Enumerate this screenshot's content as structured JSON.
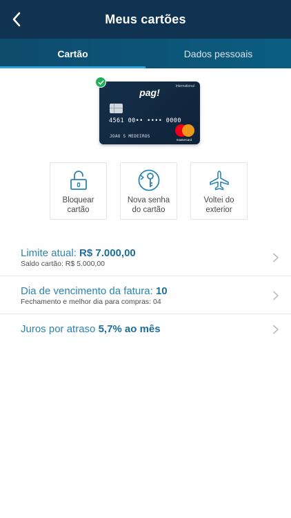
{
  "header": {
    "title": "Meus cartões"
  },
  "tabs": [
    {
      "label": "Cartão",
      "active": true
    },
    {
      "label": "Dados pessoais",
      "active": false
    }
  ],
  "card": {
    "brand": "pag!",
    "type": "International",
    "number": "4561 00•• •••• 0000",
    "holder": "JOAO S MEDEIROS",
    "network": "mastercard",
    "selected": true
  },
  "actions": [
    {
      "line1": "Bloquear",
      "line2": "cartão",
      "icon": "padlock-icon"
    },
    {
      "line1": "Nova senha",
      "line2": "do cartão",
      "icon": "key-icon"
    },
    {
      "line1": "Voltei do",
      "line2": "exterior",
      "icon": "airplane-icon"
    }
  ],
  "rows": [
    {
      "label": "Limite atual:",
      "value": "R$ 7.000,00",
      "sub": "Saldo cartão: R$ 5.000,00"
    },
    {
      "label": "Dia de vencimento da fatura:",
      "value": "10",
      "sub": "Fechamento e melhor dia para compras: 04"
    },
    {
      "label": "Juros por atraso",
      "value": "5,7% ao mês",
      "sub": ""
    }
  ],
  "colors": {
    "header_bg": "#0f3351",
    "tab_bg": "#0b5d80",
    "accent": "#2ba3dd",
    "link_text": "#2a84b1",
    "success": "#21b05a"
  }
}
